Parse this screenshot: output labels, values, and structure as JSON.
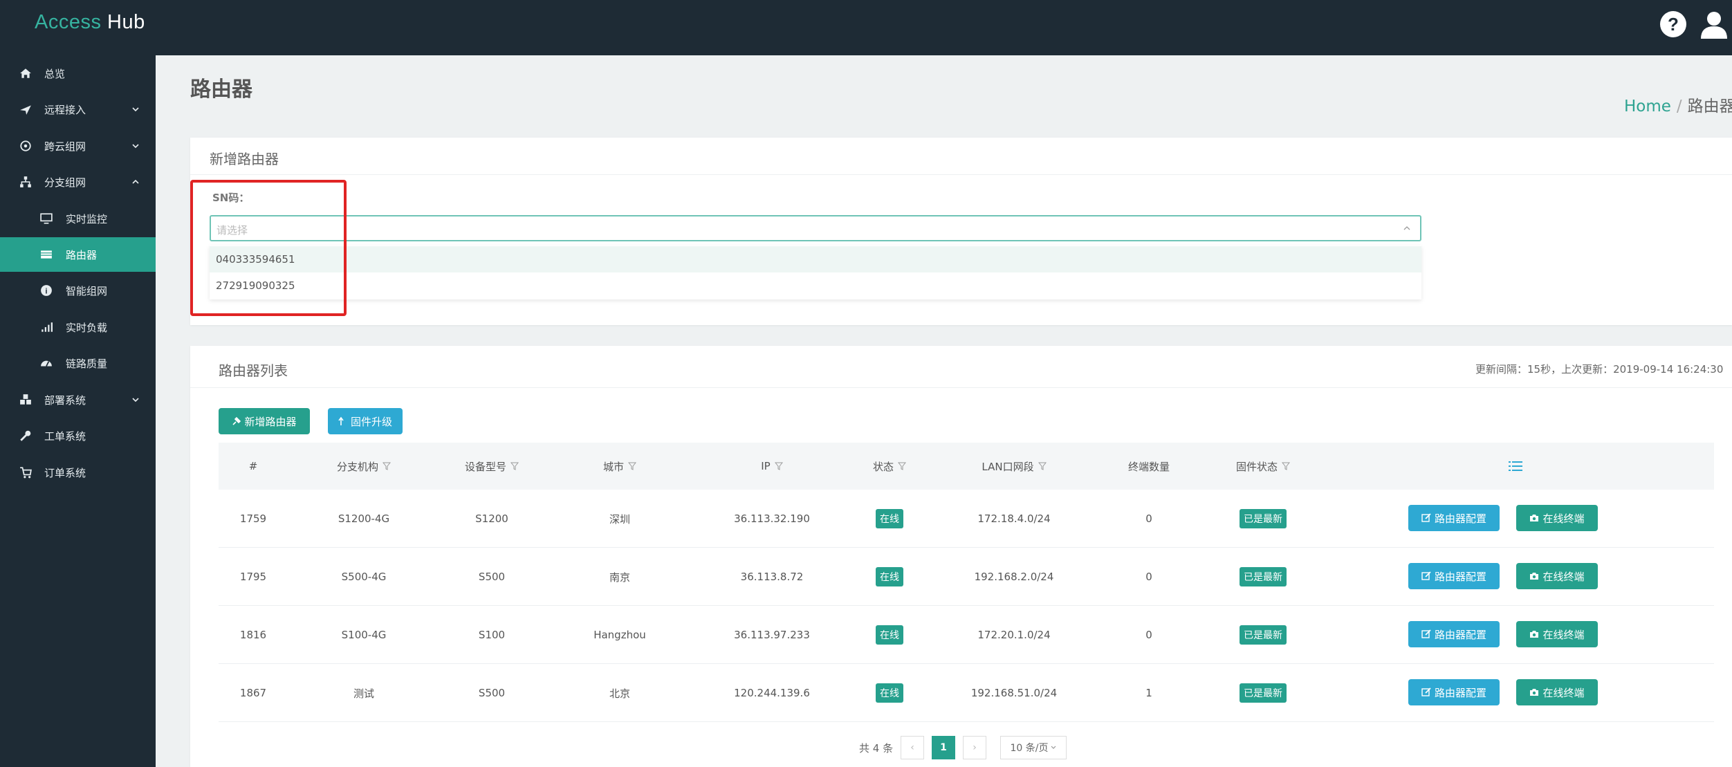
{
  "app": {
    "brand_part1": "Access ",
    "brand_part2": "Hub"
  },
  "header_icons": [
    "question-circle-icon",
    "user-icon"
  ],
  "sidebar": {
    "items": [
      {
        "label": "总览",
        "icon": "home-icon"
      },
      {
        "label": "远程接入",
        "icon": "plane-icon",
        "has_chevron": true
      },
      {
        "label": "跨云组网",
        "icon": "cloud-network-icon",
        "has_chevron": true
      },
      {
        "label": "分支组网",
        "icon": "sitemap-icon",
        "expanded": true
      },
      {
        "label": "实时监控",
        "icon": "monitor-icon",
        "sub": true
      },
      {
        "label": "路由器",
        "icon": "router-icon",
        "sub": true,
        "active": true
      },
      {
        "label": "智能组网",
        "icon": "smart-icon",
        "sub": true
      },
      {
        "label": "实时负载",
        "icon": "signal-icon",
        "sub": true
      },
      {
        "label": "链路质量",
        "icon": "gauge-icon",
        "sub": true
      },
      {
        "label": "部署系统",
        "icon": "cubes-icon",
        "has_chevron": true
      },
      {
        "label": "工单系统",
        "icon": "wrench-icon"
      },
      {
        "label": "订单系统",
        "icon": "cart-icon"
      }
    ]
  },
  "page": {
    "title": "路由器",
    "breadcrumb_home": "Home",
    "breadcrumb_sep": "/",
    "breadcrumb_current": "路由器"
  },
  "add_form": {
    "title": "新增路由器",
    "sn_label": "SN码：",
    "placeholder": "请选择",
    "options": [
      "040333594651",
      "272919090325"
    ]
  },
  "list": {
    "title": "路由器列表",
    "refresh_info": "更新间隔：15秒，上次更新：2019-09-14 16:24:30",
    "add_button": "新增路由器",
    "upgrade_button": "固件升级",
    "columns": [
      "#",
      "分支机构",
      "设备型号",
      "城市",
      "IP",
      "状态",
      "LAN口网段",
      "终端数量",
      "固件状态"
    ],
    "rows": [
      {
        "id": "1759",
        "branch": "S1200-4G",
        "model": "S1200",
        "city": "深圳",
        "ip": "36.113.32.190",
        "status": "在线",
        "lan": "172.18.4.0/24",
        "clients": "0",
        "firmware": "已是最新"
      },
      {
        "id": "1795",
        "branch": "S500-4G",
        "model": "S500",
        "city": "南京",
        "ip": "36.113.8.72",
        "status": "在线",
        "lan": "192.168.2.0/24",
        "clients": "0",
        "firmware": "已是最新"
      },
      {
        "id": "1816",
        "branch": "S100-4G",
        "model": "S100",
        "city": "Hangzhou",
        "ip": "36.113.97.233",
        "status": "在线",
        "lan": "172.20.1.0/24",
        "clients": "0",
        "firmware": "已是最新"
      },
      {
        "id": "1867",
        "branch": "测试",
        "model": "S500",
        "city": "北京",
        "ip": "120.244.139.6",
        "status": "在线",
        "lan": "192.168.51.0/24",
        "clients": "1",
        "firmware": "已是最新"
      }
    ],
    "row_btn_config": "路由器配置",
    "row_btn_terminal": "在线终端"
  },
  "pagination": {
    "total": "共 4 条",
    "prev": "‹",
    "current": "1",
    "next": "›",
    "page_size": "10 条/页"
  },
  "colors": {
    "primary": "#26a08d",
    "info": "#2ea9d3",
    "sidebar_bg": "#1e2b35",
    "highlight_border": "#e02424"
  }
}
